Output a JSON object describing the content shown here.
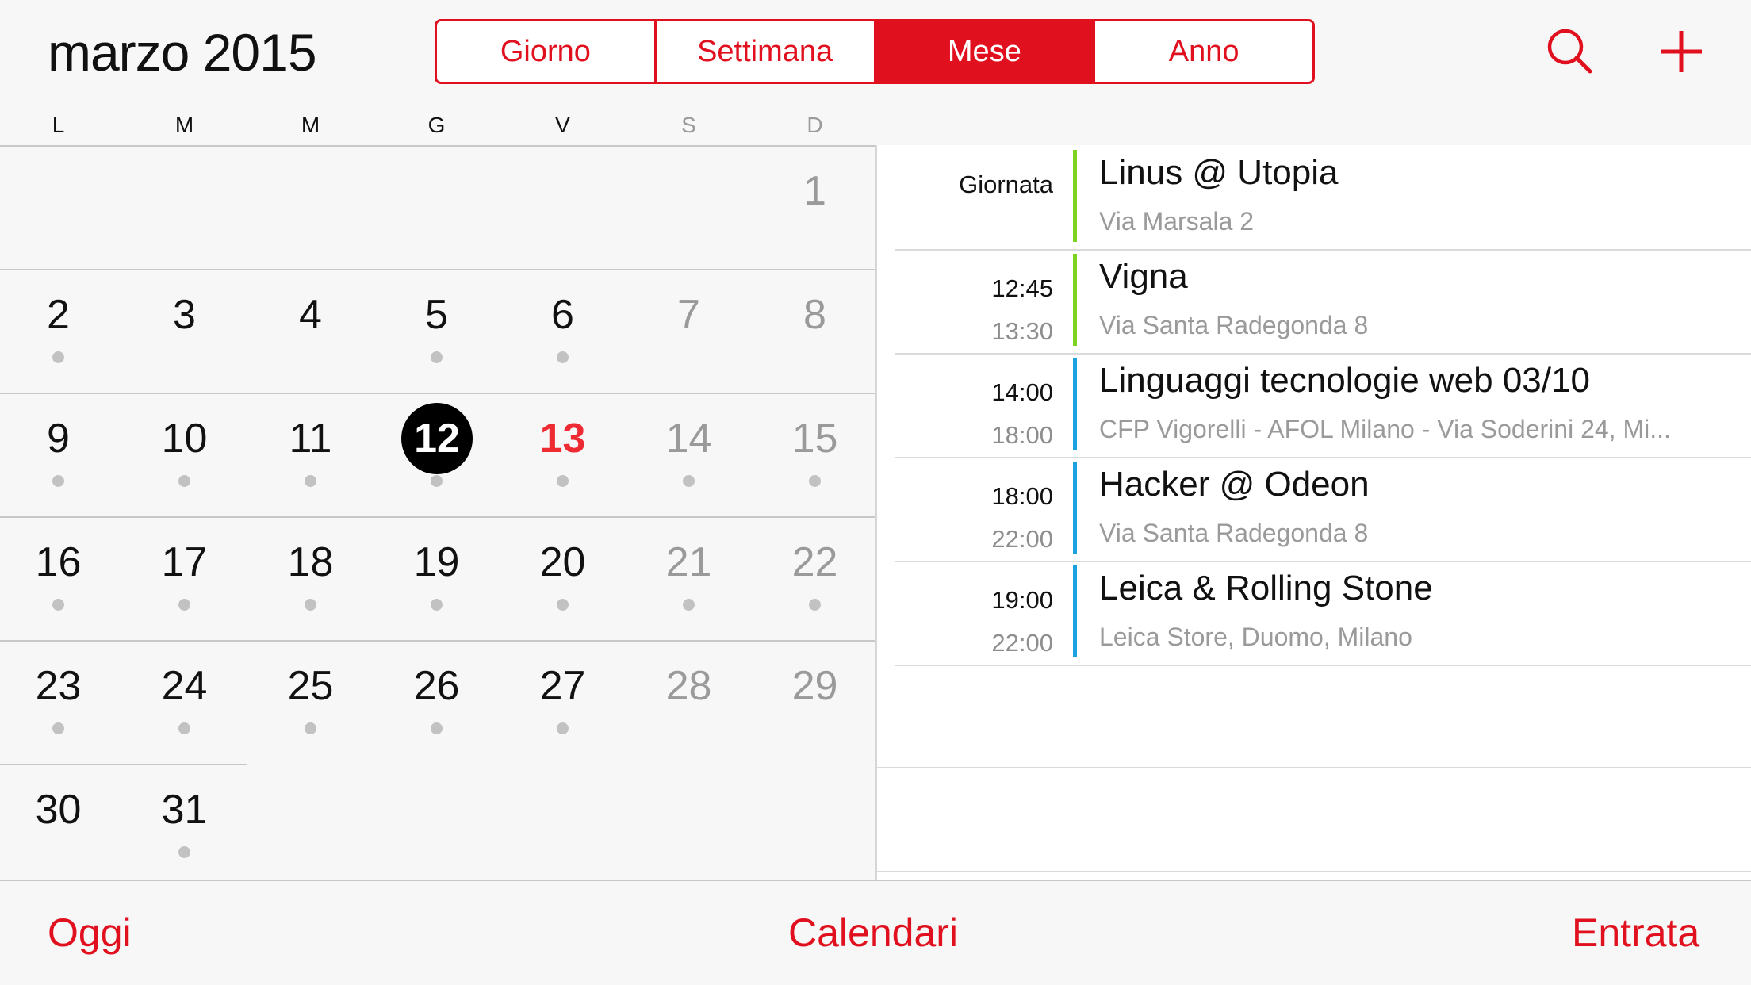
{
  "header": {
    "month_title": "marzo 2015",
    "segments": [
      "Giorno",
      "Settimana",
      "Mese",
      "Anno"
    ],
    "active_segment": "Mese",
    "search_icon": "search-icon",
    "add_icon": "plus-icon"
  },
  "weekdays": [
    "L",
    "M",
    "M",
    "G",
    "V",
    "S",
    "D"
  ],
  "month": {
    "weeks": [
      [
        null,
        null,
        null,
        null,
        null,
        null,
        {
          "n": "1",
          "dot": false
        }
      ],
      [
        {
          "n": "2",
          "dot": true
        },
        {
          "n": "3",
          "dot": false
        },
        {
          "n": "4",
          "dot": false
        },
        {
          "n": "5",
          "dot": true
        },
        {
          "n": "6",
          "dot": true
        },
        {
          "n": "7",
          "dot": false
        },
        {
          "n": "8",
          "dot": false
        }
      ],
      [
        {
          "n": "9",
          "dot": true
        },
        {
          "n": "10",
          "dot": true
        },
        {
          "n": "11",
          "dot": true
        },
        {
          "n": "12",
          "dot": true,
          "selected": true
        },
        {
          "n": "13",
          "dot": true,
          "today": true
        },
        {
          "n": "14",
          "dot": true
        },
        {
          "n": "15",
          "dot": true
        }
      ],
      [
        {
          "n": "16",
          "dot": true
        },
        {
          "n": "17",
          "dot": true
        },
        {
          "n": "18",
          "dot": true
        },
        {
          "n": "19",
          "dot": true
        },
        {
          "n": "20",
          "dot": true
        },
        {
          "n": "21",
          "dot": true
        },
        {
          "n": "22",
          "dot": true
        }
      ],
      [
        {
          "n": "23",
          "dot": true
        },
        {
          "n": "24",
          "dot": true
        },
        {
          "n": "25",
          "dot": true
        },
        {
          "n": "26",
          "dot": true
        },
        {
          "n": "27",
          "dot": true
        },
        {
          "n": "28",
          "dot": false
        },
        {
          "n": "29",
          "dot": false
        }
      ],
      [
        {
          "n": "30",
          "dot": false
        },
        {
          "n": "31",
          "dot": true
        },
        null,
        null,
        null,
        null,
        null
      ]
    ]
  },
  "events": [
    {
      "time1": "Giornata",
      "time2": "",
      "title": "Linus @ Utopia",
      "location": "Via Marsala 2",
      "color": "#7ed321"
    },
    {
      "time1": "12:45",
      "time2": "13:30",
      "title": "Vigna",
      "location": "Via Santa Radegonda 8",
      "color": "#7ed321"
    },
    {
      "time1": "14:00",
      "time2": "18:00",
      "title": "Linguaggi  tecnologie web 03/10",
      "location": "CFP Vigorelli - AFOL Milano - Via Soderini 24, Mi...",
      "color": "#1ba1e2"
    },
    {
      "time1": "18:00",
      "time2": "22:00",
      "title": "Hacker @ Odeon",
      "location": "Via Santa Radegonda 8",
      "color": "#1ba1e2"
    },
    {
      "time1": "19:00",
      "time2": "22:00",
      "title": "Leica & Rolling Stone",
      "location": "Leica Store, Duomo, Milano",
      "color": "#1ba1e2"
    }
  ],
  "toolbar": {
    "today_label": "Oggi",
    "calendars_label": "Calendari",
    "inbox_label": "Entrata"
  },
  "colors": {
    "accent": "#e0101e",
    "today": "#ee2a33"
  }
}
